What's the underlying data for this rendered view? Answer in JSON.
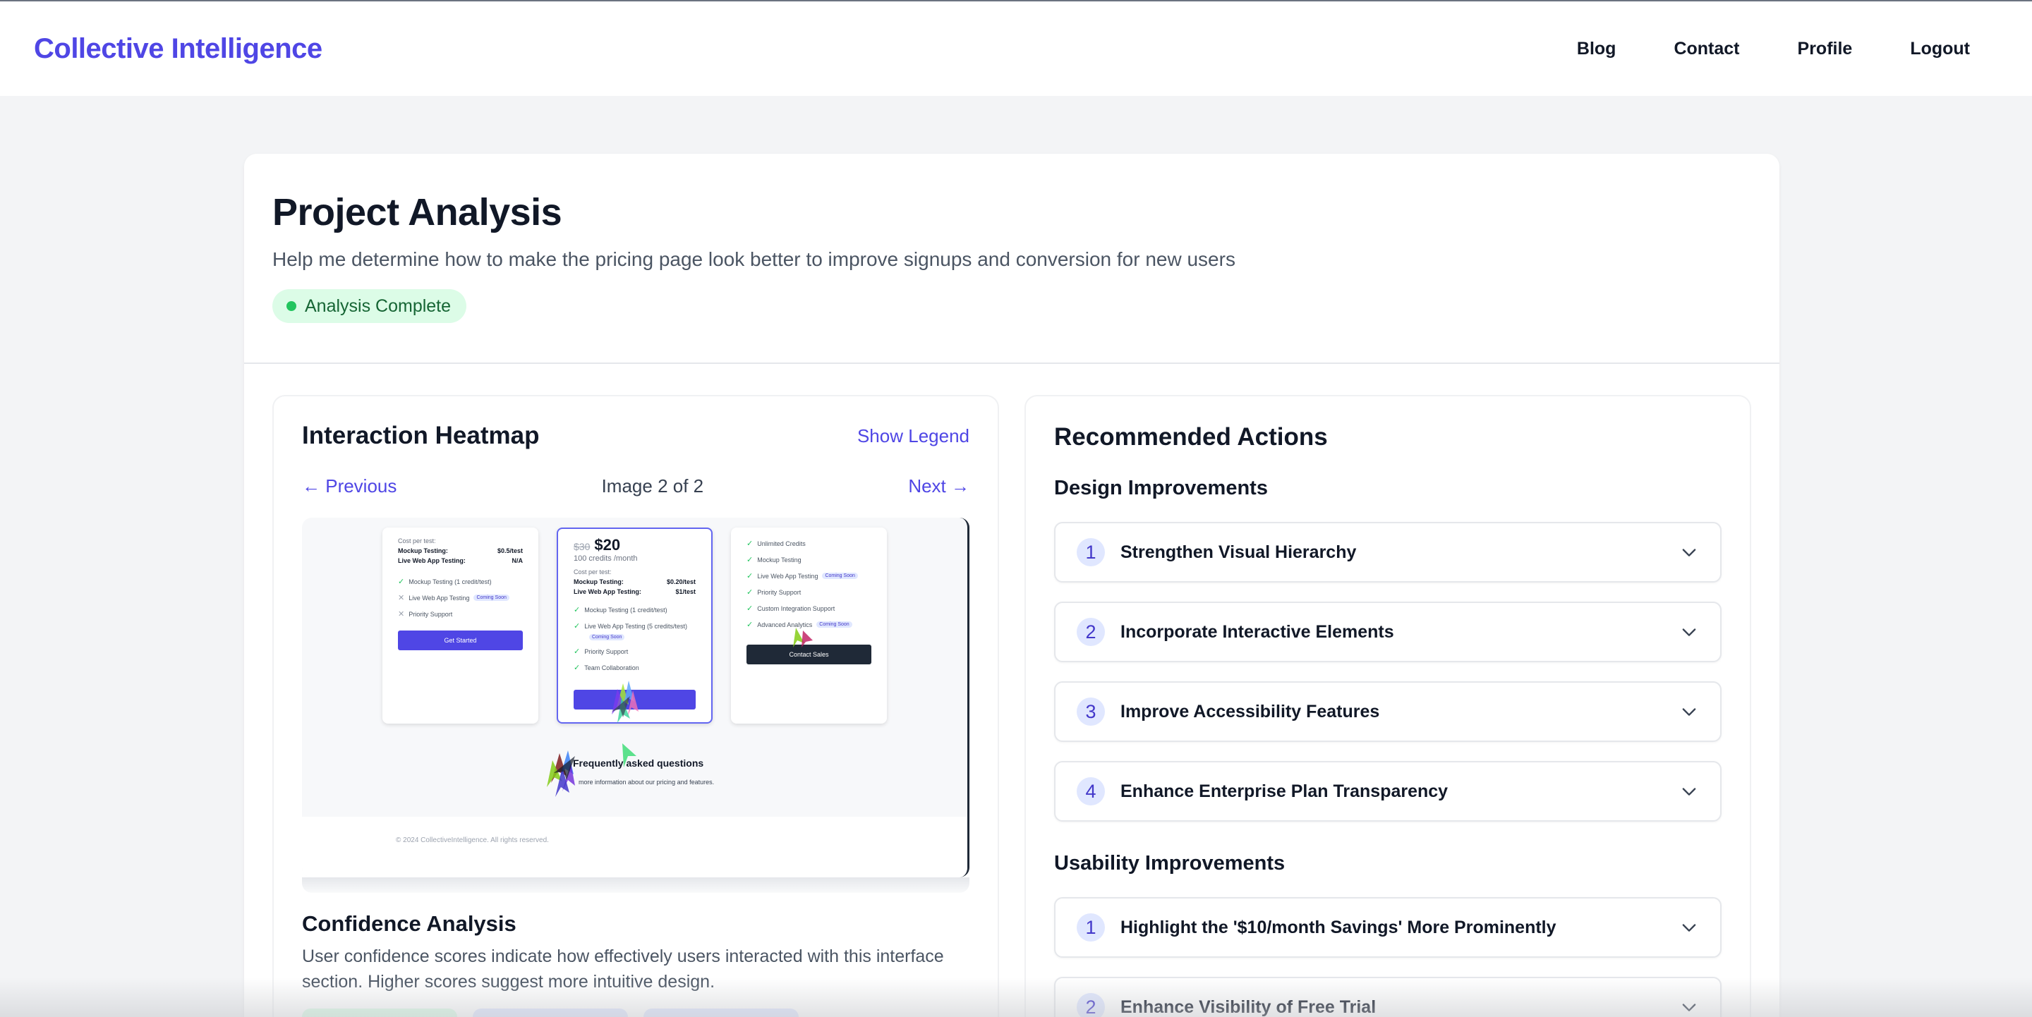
{
  "header": {
    "brand": "Collective Intelligence",
    "nav": [
      "Blog",
      "Contact",
      "Profile",
      "Logout"
    ]
  },
  "project": {
    "title": "Project Analysis",
    "description": "Help me determine how to make the pricing page look better to improve signups and conversion for new users",
    "status": "Analysis Complete"
  },
  "heatmap": {
    "title": "Interaction Heatmap",
    "legend_link": "Show Legend",
    "previous": "← Previous",
    "counter": "Image 2 of 2",
    "next": "Next →",
    "screenshot": {
      "plan_left": {
        "cost_label": "Cost per test:",
        "rows": [
          [
            "Mockup Testing:",
            "$0.5/test"
          ],
          [
            "Live Web App Testing:",
            "N/A"
          ]
        ],
        "features": [
          "Mockup Testing (1 credit/test)",
          "Live Web App Testing",
          "Priority Support"
        ],
        "coming_soon": "Coming Soon",
        "button": "Get Started"
      },
      "plan_mid": {
        "old_price": "$30",
        "price": "$20",
        "credits": "100 credits /month",
        "cost_label": "Cost per test:",
        "rows": [
          [
            "Mockup Testing:",
            "$0.20/test"
          ],
          [
            "Live Web App Testing:",
            "$1/test"
          ]
        ],
        "features": [
          "Mockup Testing (1 credit/test)",
          "Live Web App Testing (5 credits/test)",
          "Priority Support",
          "Team Collaboration"
        ],
        "coming_soon": "Coming Soon"
      },
      "plan_right": {
        "features": [
          "Unlimited Credits",
          "Mockup Testing",
          "Live Web App Testing",
          "Priority Support",
          "Custom Integration Support",
          "Advanced Analytics"
        ],
        "coming_soon": "Coming Soon",
        "button": "Contact Sales"
      },
      "faq_title": "Frequently asked questions",
      "faq_sub": "more information about our pricing and features.",
      "copyright": "© 2024 CollectiveIntelligence. All rights reserved."
    }
  },
  "confidence": {
    "title": "Confidence Analysis",
    "description": "User confidence scores indicate how effectively users interacted with this interface section. Higher scores suggest more intuitive design."
  },
  "recommendations": {
    "title": "Recommended Actions",
    "design_title": "Design Improvements",
    "design": [
      {
        "n": "1",
        "label": "Strengthen Visual Hierarchy"
      },
      {
        "n": "2",
        "label": "Incorporate Interactive Elements"
      },
      {
        "n": "3",
        "label": "Improve Accessibility Features"
      },
      {
        "n": "4",
        "label": "Enhance Enterprise Plan Transparency"
      }
    ],
    "usability_title": "Usability Improvements",
    "usability": [
      {
        "n": "1",
        "label": "Highlight the '$10/month Savings' More Prominently"
      },
      {
        "n": "2",
        "label": "Enhance Visibility of Free Trial"
      }
    ]
  },
  "colors": {
    "accent": "#4f46e5",
    "badge_bg": "#dcfce7",
    "badge_text": "#166534",
    "dark_button": "#1f2937"
  }
}
